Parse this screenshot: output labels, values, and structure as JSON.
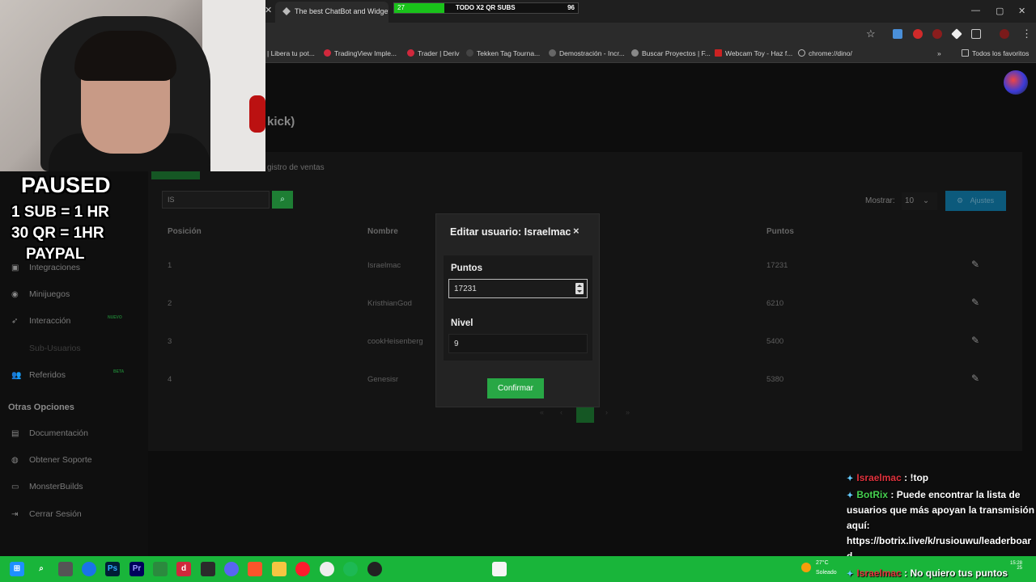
{
  "browser": {
    "tab_title": "The best ChatBot and Widgets",
    "subgoal": {
      "left": "27",
      "text": "TODO X2 QR SUBS",
      "right": "96",
      "fill": 0.27
    },
    "bookmarks": [
      "| Libera tu pot...",
      "TradingView Imple...",
      "Trader | Deriv",
      "Tekken Tag Tourna...",
      "Demostración - Incr...",
      "Buscar Proyectos | F...",
      "Webcam Toy - Haz f...",
      "chrome://dino/"
    ],
    "all_bookmarks": "Todos los favoritos"
  },
  "page": {
    "title_fragment": "kick)",
    "tab_ventas": "gistro de ventas",
    "search_value": "IS",
    "mostrar_label": "Mostrar:",
    "mostrar_value": "10",
    "ajustes_label": "Ajustes",
    "headers": {
      "pos": "Posición",
      "name": "Nombre",
      "points": "Puntos"
    },
    "rows": [
      {
        "pos": "1",
        "name": "Israelmac",
        "points": "17231"
      },
      {
        "pos": "2",
        "name": "KristhianGod",
        "points": "6210"
      },
      {
        "pos": "3",
        "name": "cookHeisenberg",
        "points": "5400"
      },
      {
        "pos": "4",
        "name": "Genesisr",
        "points": "5380"
      }
    ],
    "pagination": {
      "first": "«",
      "prev": "‹",
      "current": "1",
      "next": "›",
      "last": "»"
    }
  },
  "sidebar": {
    "items": [
      {
        "label": "Integraciones",
        "icon": "plug-icon"
      },
      {
        "label": "Minijuegos",
        "icon": "gamepad-icon"
      },
      {
        "label": "Interacción",
        "icon": "rocket-icon",
        "badge": "NUEVO"
      },
      {
        "label": "Sub-Usuarios",
        "icon": "users-icon"
      },
      {
        "label": "Referidos",
        "icon": "people-icon",
        "badge": "BETA"
      }
    ],
    "otras_title": "Otras Opciones",
    "otras": [
      {
        "label": "Documentación",
        "icon": "book-icon"
      },
      {
        "label": "Obtener Soporte",
        "icon": "support-icon"
      },
      {
        "label": "MonsterBuilds",
        "icon": "monitor-icon"
      },
      {
        "label": "Cerrar Sesión",
        "icon": "logout-icon"
      }
    ]
  },
  "overlay": {
    "paused": "PAUSED",
    "line1": "1 SUB = 1 HR",
    "line2": "30 QR = 1HR",
    "line3": "PAYPAL"
  },
  "modal": {
    "title": "Editar usuario: Israelmac",
    "close": "×",
    "puntos_label": "Puntos",
    "puntos_value": "17231",
    "nivel_label": "Nivel",
    "nivel_value": "9",
    "confirm": "Confirmar"
  },
  "chat": [
    {
      "user": "Israelmac",
      "msg": " : !top"
    },
    {
      "user": "BotRix",
      "msg": " : Puede encontrar la lista de"
    },
    {
      "line": "usuarios que más apoyan la transmisión"
    },
    {
      "line": "aquí:"
    },
    {
      "line": "https://botrix.live/k/rusiouwu/leaderboar"
    },
    {
      "line": "d"
    },
    {
      "user": "Israelmac",
      "msg": " : No quiero tus puntos"
    }
  ],
  "taskbar": {
    "temp": "27°C",
    "weather": "Soleado",
    "time": "15:28",
    "date": "25"
  }
}
